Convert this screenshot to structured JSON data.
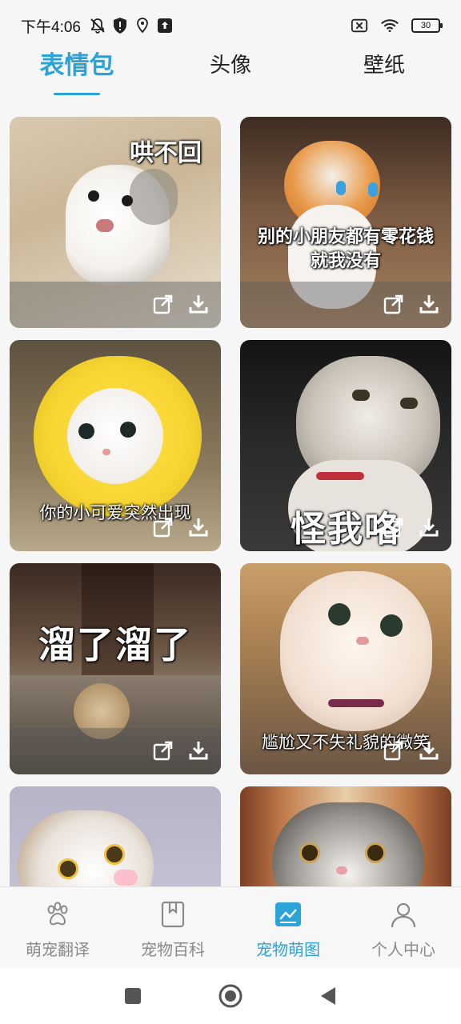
{
  "status_bar": {
    "time": "下午4:06",
    "battery": "30",
    "icons": [
      "mute-icon",
      "shield-icon",
      "location-icon",
      "upload-icon",
      "no-sim-icon",
      "wifi-icon",
      "battery-icon"
    ]
  },
  "tabs": [
    {
      "label": "表情包",
      "active": true
    },
    {
      "label": "头像",
      "active": false
    },
    {
      "label": "壁纸",
      "active": false
    }
  ],
  "cards": [
    {
      "caption": "哄不回"
    },
    {
      "caption": "别的小朋友都有零花钱\n就我没有"
    },
    {
      "caption": "你的小可爱突然出现"
    },
    {
      "caption": "怪我咯"
    },
    {
      "caption": "溜了溜了"
    },
    {
      "caption": "尴尬又不失礼貌的微笑"
    },
    {
      "caption": ""
    },
    {
      "caption": ""
    }
  ],
  "bottom_nav": [
    {
      "label": "萌宠翻译",
      "icon": "paw-icon",
      "active": false
    },
    {
      "label": "宠物百科",
      "icon": "book-icon",
      "active": false
    },
    {
      "label": "宠物萌图",
      "icon": "image-chart-icon",
      "active": true
    },
    {
      "label": "个人中心",
      "icon": "person-icon",
      "active": false
    }
  ],
  "colors": {
    "accent": "#2aa3d9",
    "inactive": "#8a8a8a"
  }
}
